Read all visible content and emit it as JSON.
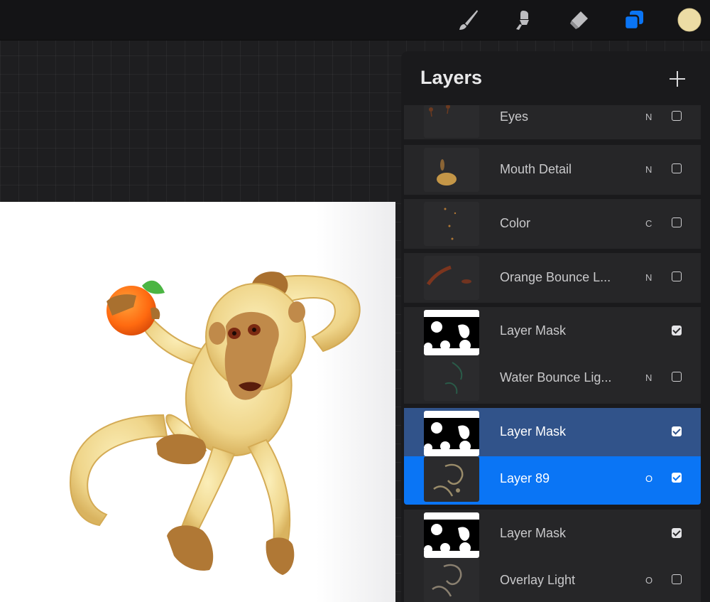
{
  "toolbar": {
    "tools": [
      {
        "name": "brush",
        "icon": "paintbrush-icon"
      },
      {
        "name": "smudge",
        "icon": "smudge-icon"
      },
      {
        "name": "eraser",
        "icon": "eraser-icon"
      },
      {
        "name": "layers",
        "icon": "layers-icon",
        "active": true,
        "color": "#0a75f5"
      },
      {
        "name": "color",
        "icon": "color-swatch-icon",
        "color": "#ecdca5"
      }
    ]
  },
  "layers_panel": {
    "title": "Layers",
    "add_icon": "plus-icon",
    "layers": [
      {
        "name": "Eyes",
        "blend": "N",
        "visible": false
      },
      {
        "name": "Mouth Detail",
        "blend": "N",
        "visible": false
      },
      {
        "name": "Color",
        "blend": "C",
        "visible": false
      },
      {
        "name": "Orange Bounce L...",
        "blend": "N",
        "visible": false
      },
      {
        "name": "Layer Mask",
        "blend": "",
        "visible": true,
        "is_mask": true
      },
      {
        "name": "Water Bounce Lig...",
        "blend": "N",
        "visible": false
      },
      {
        "name": "Layer Mask",
        "blend": "",
        "visible": true,
        "is_mask": true
      },
      {
        "name": "Layer 89",
        "blend": "O",
        "visible": true,
        "selected": true
      },
      {
        "name": "Layer Mask",
        "blend": "",
        "visible": true,
        "is_mask": true
      },
      {
        "name": "Overlay Light",
        "blend": "O",
        "visible": false
      }
    ]
  },
  "colors": {
    "selected": "#0a75f5",
    "mask_selected": "#31538a",
    "row": "#262628"
  }
}
